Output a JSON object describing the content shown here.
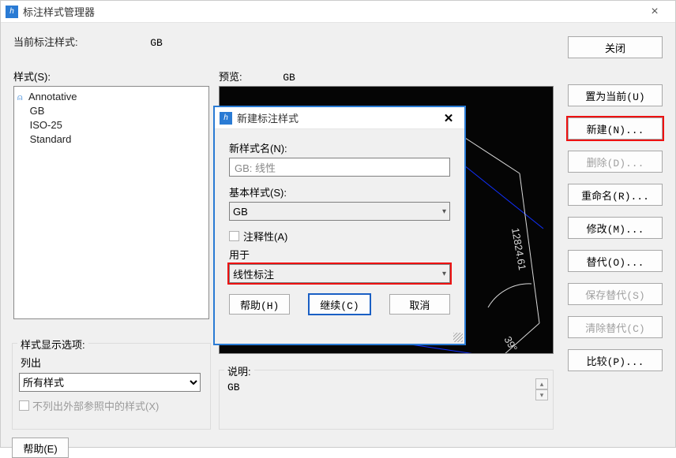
{
  "window": {
    "title": "标注样式管理器",
    "close_glyph": "×"
  },
  "current": {
    "label": "当前标注样式:",
    "value": "GB"
  },
  "styles": {
    "label": "样式(S):",
    "items": [
      "Annotative",
      "GB",
      "ISO-25",
      "Standard"
    ]
  },
  "display": {
    "legend": "样式显示选项:",
    "list_label": "列出",
    "select_value": "所有样式",
    "checkbox_label": "不列出外部参照中的样式(X)"
  },
  "help_button": "帮助(E)",
  "preview": {
    "label": "预览:",
    "value": "GB",
    "dim_value": "12824.61",
    "angle": "39°"
  },
  "description": {
    "legend": "说明:",
    "value": "GB"
  },
  "right_buttons": {
    "set_current": "置为当前(U)",
    "new": "新建(N)...",
    "delete": "删除(D)...",
    "rename": "重命名(R)...",
    "modify": "修改(M)...",
    "override": "替代(O)...",
    "save_override": "保存替代(S)",
    "clear_override": "清除替代(C)",
    "compare": "比较(P)..."
  },
  "close_button": "关闭",
  "modal": {
    "title": "新建标注样式",
    "close_glyph": "✕",
    "new_name_label": "新样式名(N):",
    "new_name_value": "GB: 线性",
    "base_label": "基本样式(S):",
    "base_value": "GB",
    "annotative_label": "注释性(A)",
    "used_for_label": "用于",
    "used_for_value": "线性标注",
    "help": "帮助(H)",
    "continue": "继续(C)",
    "cancel": "取消"
  }
}
